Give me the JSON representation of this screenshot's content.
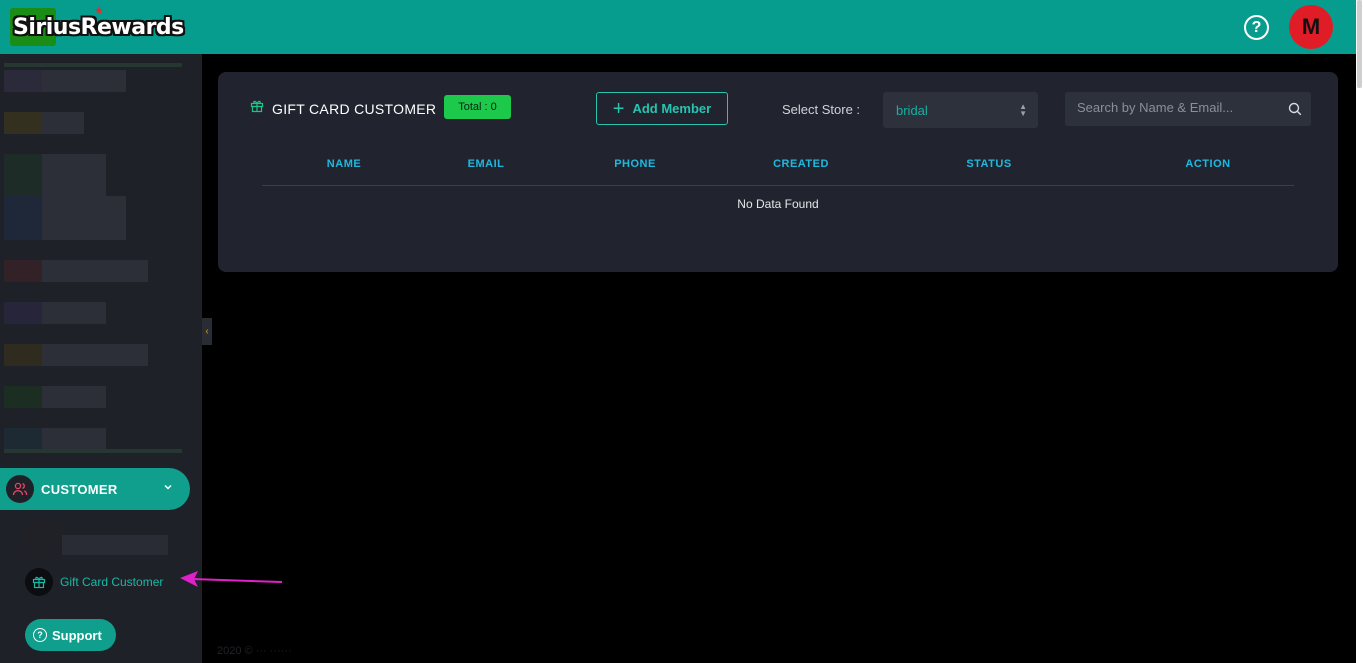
{
  "header": {
    "logo_text": "SiriusRewards",
    "help_icon": "question-circle-icon",
    "avatar_letter": "M"
  },
  "sidebar": {
    "customer_label": "CUSTOMER",
    "giftcard_label": "Gift Card Customer",
    "support_label": "Support"
  },
  "main": {
    "card_title": "GIFT CARD CUSTOMER",
    "total_badge": "Total : 0",
    "add_member_label": "Add Member",
    "store_label": "Select Store :",
    "store_value": "bridal",
    "search_placeholder": "Search by Name & Email...",
    "columns": [
      "NAME",
      "EMAIL",
      "PHONE",
      "CREATED",
      "STATUS",
      "ACTION"
    ],
    "empty_text": "No Data Found"
  },
  "colors": {
    "accent": "#079d8e",
    "avatar": "#e01d26",
    "badge": "#1dc94b",
    "annotation_arrow": "#e020c8"
  }
}
